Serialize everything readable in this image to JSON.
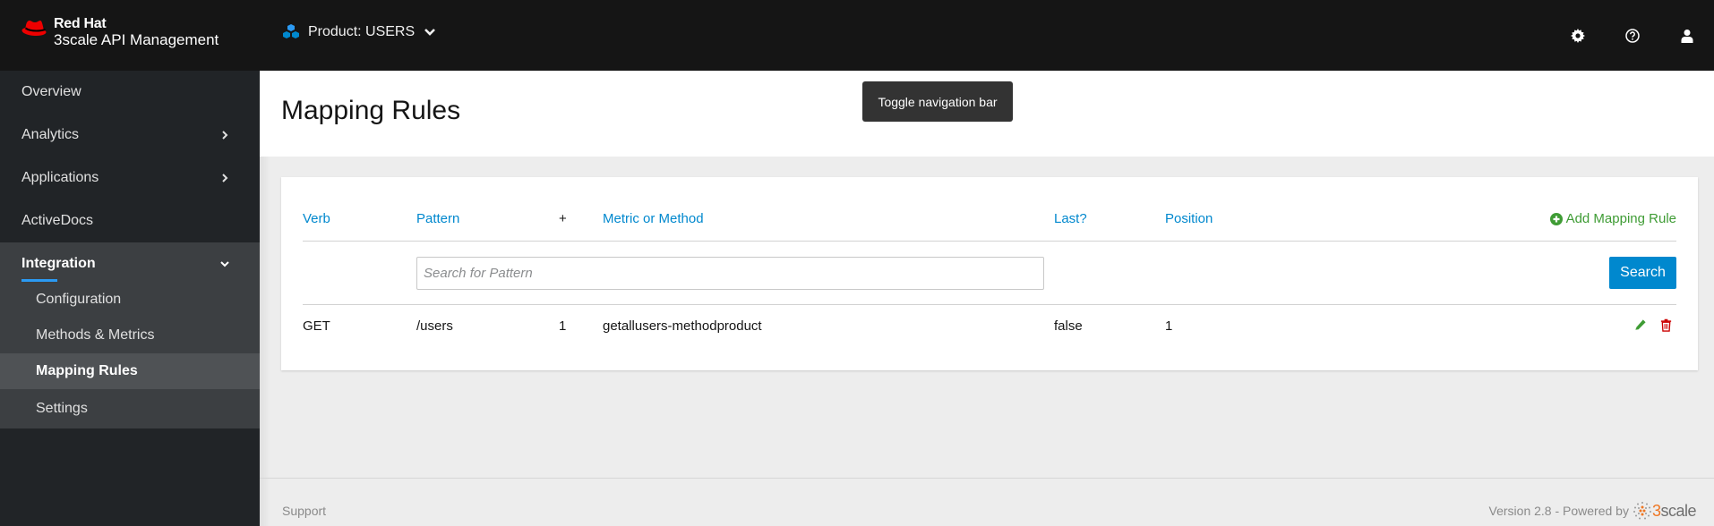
{
  "header": {
    "brand_line1": "Red Hat",
    "brand_line2": "3scale API Management",
    "product_label": "Product: USERS",
    "icons": [
      "gear-icon",
      "help-icon",
      "user-icon"
    ]
  },
  "sidebar": {
    "items": [
      {
        "label": "Overview",
        "has_chevron": false
      },
      {
        "label": "Analytics",
        "has_chevron": true
      },
      {
        "label": "Applications",
        "has_chevron": true
      },
      {
        "label": "ActiveDocs",
        "has_chevron": false
      }
    ],
    "group": {
      "label": "Integration",
      "expanded": true,
      "items": [
        {
          "label": "Configuration",
          "active": false
        },
        {
          "label": "Methods & Metrics",
          "active": false
        },
        {
          "label": "Mapping Rules",
          "active": true
        },
        {
          "label": "Settings",
          "active": false
        }
      ]
    }
  },
  "page": {
    "title": "Mapping Rules",
    "tooltip": "Toggle navigation bar"
  },
  "table": {
    "columns": {
      "verb": "Verb",
      "pattern": "Pattern",
      "plus": "+",
      "metric": "Metric or Method",
      "last": "Last?",
      "position": "Position"
    },
    "add_rule_label": "Add Mapping Rule",
    "search_placeholder": "Search for Pattern",
    "search_value": "",
    "search_button": "Search",
    "rows": [
      {
        "verb": "GET",
        "pattern": "/users",
        "delta": "1",
        "metric": "getallusers-methodproduct",
        "last": "false",
        "position": "1"
      }
    ]
  },
  "footer": {
    "support": "Support",
    "version": "Version 2.8 - Powered by",
    "logo_text_accent": "3",
    "logo_text_rest": "scale"
  },
  "colors": {
    "masthead": "#151515",
    "sidebar": "#212427",
    "link": "#0088ce",
    "add": "#3f9c35",
    "danger": "#cc0000",
    "brand_red": "#ee0000"
  }
}
